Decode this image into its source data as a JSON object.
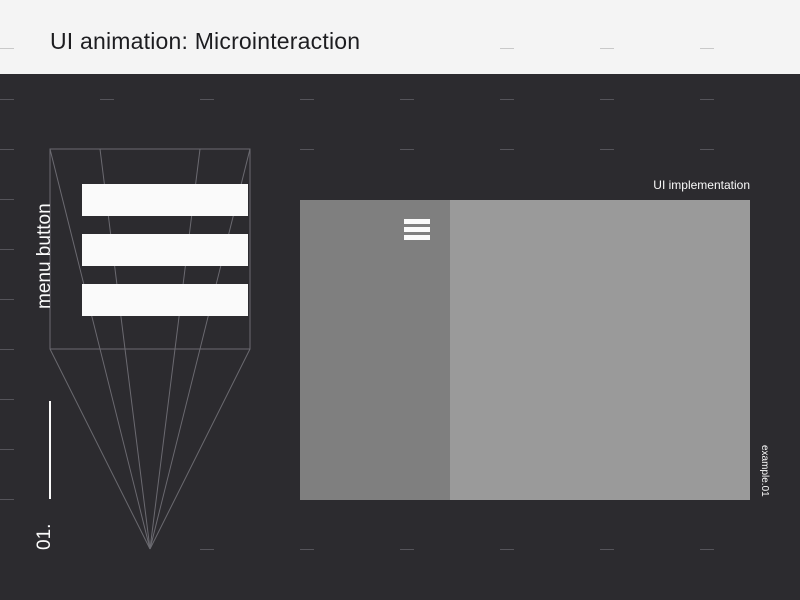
{
  "header": {
    "title": "UI animation: Microinteraction"
  },
  "left": {
    "vertical_label": "menu button",
    "index": "01."
  },
  "preview": {
    "label": "UI implementation",
    "example_tag": "example.01"
  },
  "colors": {
    "background": "#2c2b2f",
    "header": "#f4f4f4",
    "screen": "#9a9a9a",
    "screen_sidebar": "#7f7f7f",
    "white": "#fafafa"
  }
}
